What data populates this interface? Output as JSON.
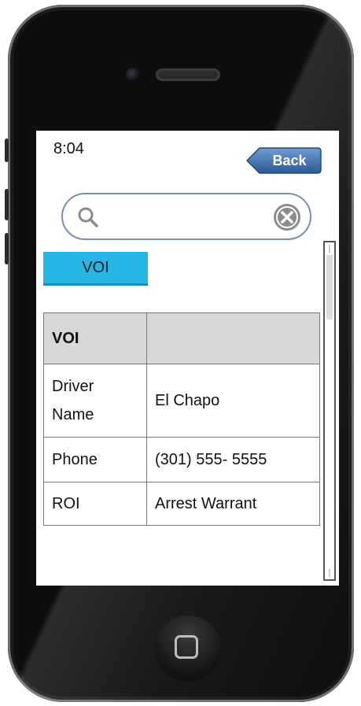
{
  "status_bar": {
    "time": "8:04"
  },
  "nav": {
    "back_label": "Back"
  },
  "search": {
    "value": "",
    "placeholder": ""
  },
  "tab": {
    "label": "VOI"
  },
  "table": {
    "header": [
      "VOI",
      ""
    ],
    "rows": [
      {
        "key": "Driver Name",
        "value": "El Chapo"
      },
      {
        "key": "Phone",
        "value": "(301) 555- 5555"
      },
      {
        "key": "ROI",
        "value": "Arrest Warrant"
      }
    ]
  },
  "colors": {
    "tab": "#27b5e6",
    "back": "#2f5f9a",
    "header_bg": "#d8d8d8",
    "search_border": "#7d8fa8"
  },
  "icons": {
    "search": "search-icon",
    "clear": "clear-icon",
    "home": "home-button-icon"
  }
}
